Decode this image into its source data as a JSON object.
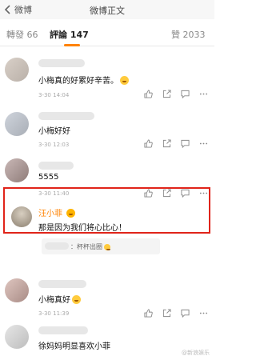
{
  "header": {
    "back_label": "微博",
    "title": "微博正文"
  },
  "tabs": {
    "repost": "轉發 66",
    "comment": "評論 147",
    "like": "贊 2033"
  },
  "comments": [
    {
      "text": "小梅真的好累好辛苦。",
      "time": "3-30 14:04"
    },
    {
      "text": "小梅好好",
      "time": "3-30 12:03"
    },
    {
      "text": "5555",
      "time": "3-30 11:40"
    },
    {
      "name": "汪小菲",
      "text": "那是因为我们将心比心！"
    },
    {
      "text": "小梅真好",
      "time": "3-30 11:39"
    },
    {
      "text": "徐妈妈明显喜欢小菲"
    }
  ],
  "reply": {
    "text": "：杯杯出圈"
  },
  "watermark": "@新浪娱乐",
  "colors": {
    "accent": "#ff8200",
    "highlight_border": "#e0241a"
  },
  "icons": [
    "back-arrow-icon",
    "like-icon",
    "share-icon",
    "comment-icon",
    "more-icon",
    "crown-badge-icon"
  ]
}
